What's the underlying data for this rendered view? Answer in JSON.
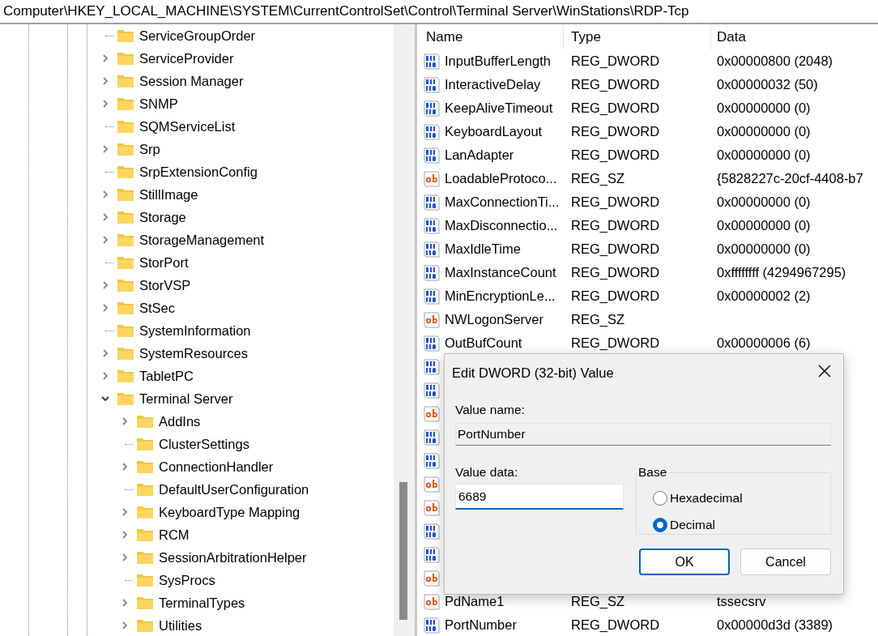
{
  "address_bar": {
    "path": "Computer\\HKEY_LOCAL_MACHINE\\SYSTEM\\CurrentControlSet\\Control\\Terminal Server\\WinStations\\RDP-Tcp"
  },
  "tree": {
    "items": [
      {
        "label": "ServiceGroupOrder",
        "kind": "leaf"
      },
      {
        "label": "ServiceProvider",
        "kind": "collapsed"
      },
      {
        "label": "Session Manager",
        "kind": "collapsed"
      },
      {
        "label": "SNMP",
        "kind": "collapsed"
      },
      {
        "label": "SQMServiceList",
        "kind": "leaf"
      },
      {
        "label": "Srp",
        "kind": "collapsed"
      },
      {
        "label": "SrpExtensionConfig",
        "kind": "leaf"
      },
      {
        "label": "StillImage",
        "kind": "collapsed"
      },
      {
        "label": "Storage",
        "kind": "collapsed"
      },
      {
        "label": "StorageManagement",
        "kind": "collapsed"
      },
      {
        "label": "StorPort",
        "kind": "leaf"
      },
      {
        "label": "StorVSP",
        "kind": "collapsed"
      },
      {
        "label": "StSec",
        "kind": "collapsed"
      },
      {
        "label": "SystemInformation",
        "kind": "leaf"
      },
      {
        "label": "SystemResources",
        "kind": "collapsed"
      },
      {
        "label": "TabletPC",
        "kind": "collapsed"
      },
      {
        "label": "Terminal Server",
        "kind": "expanded",
        "children": [
          {
            "label": "AddIns",
            "kind": "collapsed"
          },
          {
            "label": "ClusterSettings",
            "kind": "leaf"
          },
          {
            "label": "ConnectionHandler",
            "kind": "collapsed"
          },
          {
            "label": "DefaultUserConfiguration",
            "kind": "leaf"
          },
          {
            "label": "KeyboardType Mapping",
            "kind": "collapsed"
          },
          {
            "label": "RCM",
            "kind": "collapsed"
          },
          {
            "label": "SessionArbitrationHelper",
            "kind": "collapsed"
          },
          {
            "label": "SysProcs",
            "kind": "leaf"
          },
          {
            "label": "TerminalTypes",
            "kind": "collapsed"
          },
          {
            "label": "Utilities",
            "kind": "collapsed"
          }
        ]
      }
    ]
  },
  "values": {
    "columns": [
      "Name",
      "Type",
      "Data"
    ],
    "rows": [
      {
        "kind": "dword",
        "name": "InputBufferLength",
        "type": "REG_DWORD",
        "data": "0x00000800 (2048)"
      },
      {
        "kind": "dword",
        "name": "InteractiveDelay",
        "type": "REG_DWORD",
        "data": "0x00000032 (50)"
      },
      {
        "kind": "dword",
        "name": "KeepAliveTimeout",
        "type": "REG_DWORD",
        "data": "0x00000000 (0)"
      },
      {
        "kind": "dword",
        "name": "KeyboardLayout",
        "type": "REG_DWORD",
        "data": "0x00000000 (0)"
      },
      {
        "kind": "dword",
        "name": "LanAdapter",
        "type": "REG_DWORD",
        "data": "0x00000000 (0)"
      },
      {
        "kind": "sz",
        "name": "LoadableProtoco...",
        "type": "REG_SZ",
        "data": "{5828227c-20cf-4408-b7"
      },
      {
        "kind": "dword",
        "name": "MaxConnectionTi...",
        "type": "REG_DWORD",
        "data": "0x00000000 (0)"
      },
      {
        "kind": "dword",
        "name": "MaxDisconnectio...",
        "type": "REG_DWORD",
        "data": "0x00000000 (0)"
      },
      {
        "kind": "dword",
        "name": "MaxIdleTime",
        "type": "REG_DWORD",
        "data": "0x00000000 (0)"
      },
      {
        "kind": "dword",
        "name": "MaxInstanceCount",
        "type": "REG_DWORD",
        "data": "0xffffffff (4294967295)"
      },
      {
        "kind": "dword",
        "name": "MinEncryptionLe...",
        "type": "REG_DWORD",
        "data": "0x00000002 (2)"
      },
      {
        "kind": "sz",
        "name": "NWLogonServer",
        "type": "REG_SZ"
      },
      {
        "kind": "dword",
        "name": "OutBufCount",
        "type": "REG_DWORD",
        "data": "0x00000006 (6)"
      },
      {
        "kind": "dword"
      },
      {
        "kind": "dword"
      },
      {
        "kind": "sz"
      },
      {
        "kind": "dword"
      },
      {
        "kind": "dword"
      },
      {
        "kind": "sz"
      },
      {
        "kind": "sz"
      },
      {
        "kind": "dword"
      },
      {
        "kind": "dword"
      },
      {
        "kind": "sz"
      },
      {
        "kind": "sz",
        "name": "PdName1",
        "type": "REG_SZ",
        "data": "tssecsrv"
      },
      {
        "kind": "dword",
        "name": "PortNumber",
        "type": "REG_DWORD",
        "data": "0x00000d3d (3389)"
      }
    ]
  },
  "dialog": {
    "title": "Edit DWORD (32-bit) Value",
    "value_name_label": "Value name:",
    "value_name": "PortNumber",
    "value_data_label": "Value data:",
    "value_data": "6689",
    "base_label": "Base",
    "base_options": [
      {
        "label": "Hexadecimal",
        "selected": false
      },
      {
        "label": "Decimal",
        "selected": true
      }
    ],
    "buttons": [
      {
        "label": "OK",
        "kind": "primary"
      },
      {
        "label": "Cancel",
        "kind": "secondary"
      }
    ]
  }
}
